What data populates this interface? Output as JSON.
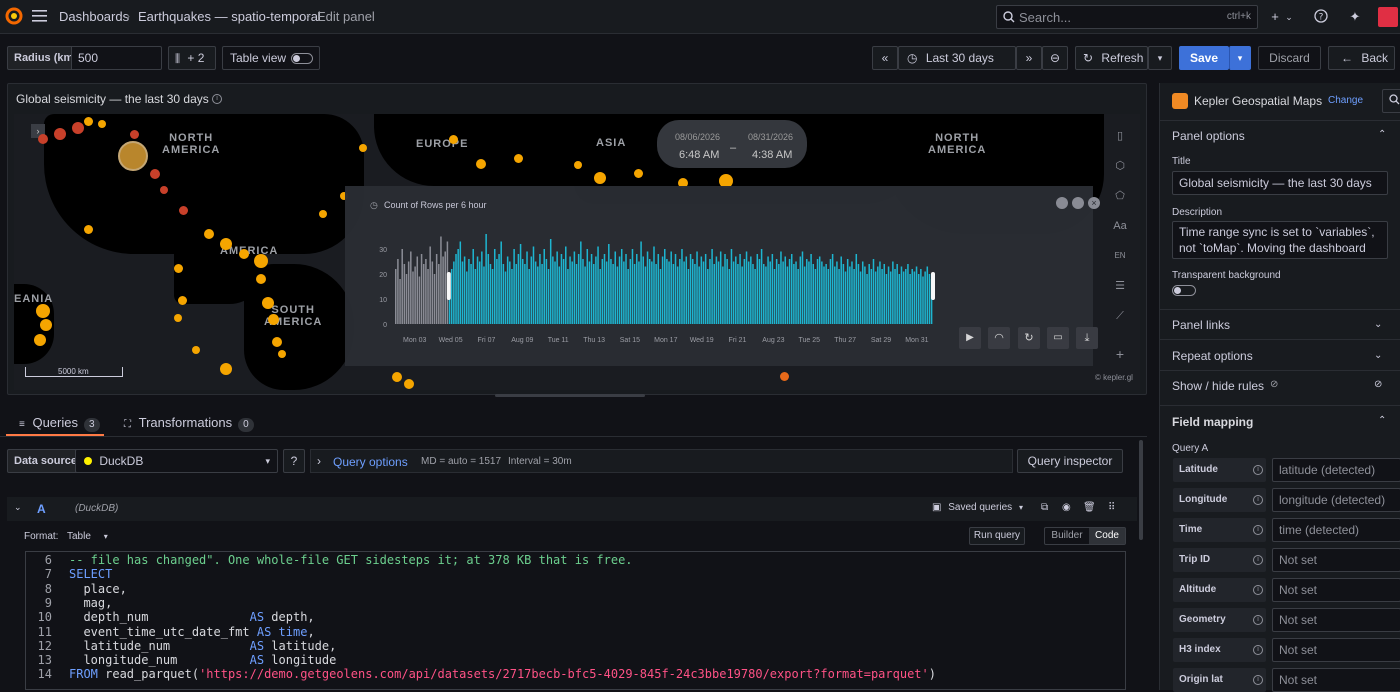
{
  "breadcrumb": [
    "Dashboards",
    "Earthquakes — spatio-temporal",
    "Edit panel"
  ],
  "search": {
    "placeholder": "Search...",
    "shortcut": "ctrl+k"
  },
  "toolbar": {
    "radius_label": "Radius (km)",
    "radius_value": "500",
    "extra_vars": "+ 2",
    "table_view": "Table view",
    "time_range": "Last 30 days",
    "refresh": "Refresh",
    "save": "Save",
    "discard": "Discard",
    "back": "Back"
  },
  "panel": {
    "title": "Global seismicity — the last 30 days",
    "map_labels": [
      "NORTH\nAMERICA",
      "EUROPE",
      "ASIA",
      "NORTH\nAMERICA",
      "AMERICA",
      "SOUTH\nAMERICA",
      "EANIA"
    ],
    "scale_label": "5000 km",
    "attribution": "© kepler.gl",
    "range_start_date": "08/06/2026",
    "range_start_time": "6:48 AM",
    "range_end_date": "08/31/2026",
    "range_end_time": "4:38 AM",
    "range_dash": "–"
  },
  "chart_data": {
    "type": "bar",
    "title": "Count of Rows per 6 hour",
    "ylim": [
      0,
      40
    ],
    "yticks": [
      0,
      10,
      20,
      30
    ],
    "xticks": [
      "Mon 03",
      "Wed 05",
      "Fri 07",
      "Aug 09",
      "Tue 11",
      "Thu 13",
      "Sat 15",
      "Mon 17",
      "Wed 19",
      "Fri 21",
      "Aug 23",
      "Tue 25",
      "Thu 27",
      "Sat 29",
      "Mon 31"
    ],
    "selected_start_index": 25,
    "values": [
      22,
      26,
      18,
      30,
      24,
      20,
      25,
      29,
      21,
      23,
      27,
      19,
      28,
      24,
      26,
      22,
      31,
      25,
      20,
      28,
      24,
      35,
      27,
      29,
      33,
      18,
      22,
      25,
      28,
      30,
      33,
      25,
      27,
      21,
      26,
      24,
      30,
      22,
      27,
      25,
      29,
      23,
      36,
      28,
      24,
      22,
      30,
      26,
      28,
      33,
      24,
      21,
      27,
      25,
      22,
      30,
      24,
      28,
      32,
      26,
      24,
      29,
      22,
      27,
      31,
      25,
      23,
      28,
      24,
      30,
      26,
      22,
      34,
      27,
      25,
      29,
      23,
      28,
      26,
      31,
      22,
      27,
      25,
      29,
      24,
      28,
      33,
      26,
      23,
      30,
      25,
      28,
      24,
      27,
      31,
      22,
      26,
      28,
      25,
      32,
      26,
      24,
      29,
      23,
      27,
      30,
      25,
      28,
      22,
      26,
      30,
      24,
      28,
      25,
      33,
      27,
      23,
      29,
      26,
      25,
      31,
      24,
      28,
      22,
      27,
      30,
      26,
      25,
      29,
      24,
      28,
      23,
      26,
      30,
      25,
      27,
      22,
      28,
      26,
      24,
      29,
      23,
      27,
      25,
      28,
      22,
      26,
      30,
      24,
      27,
      25,
      29,
      23,
      28,
      26,
      22,
      30,
      25,
      27,
      24,
      28,
      23,
      26,
      29,
      25,
      27,
      24,
      22,
      28,
      26,
      30,
      24,
      23,
      27,
      25,
      28,
      22,
      26,
      24,
      29,
      25,
      27,
      23,
      26,
      28,
      24,
      25,
      22,
      27,
      29,
      23,
      26,
      25,
      28,
      24,
      22,
      26,
      27,
      25,
      23,
      24,
      22,
      26,
      28,
      23,
      25,
      22,
      27,
      24,
      21,
      26,
      23,
      25,
      22,
      28,
      24,
      21,
      25,
      23,
      20,
      24,
      22,
      26,
      21,
      23,
      25,
      22,
      24,
      20,
      23,
      21,
      25,
      22,
      24,
      20,
      23,
      21,
      22,
      24,
      20,
      22,
      21,
      23,
      20,
      22,
      19,
      21,
      23,
      20,
      18
    ]
  },
  "queries": {
    "tab_queries": "Queries",
    "queries_count": "3",
    "tab_transformations": "Transformations",
    "transformations_count": "0",
    "datasource_label": "Data source",
    "datasource": "DuckDB",
    "query_options": "Query options",
    "md": "MD = auto = 1517",
    "interval": "Interval = 30m",
    "inspector": "Query inspector",
    "ref_id": "A",
    "ref_source": "(DuckDB)",
    "saved_queries": "Saved queries",
    "format_label": "Format:",
    "format_value": "Table",
    "run_query": "Run query",
    "builder": "Builder",
    "code": "Code"
  },
  "code_lines": [
    {
      "n": "6",
      "parts": [
        [
          "cm",
          "-- file has changed\". One whole-file GET sidesteps it; at 378 KB that is free."
        ]
      ]
    },
    {
      "n": "7",
      "parts": [
        [
          "kw",
          "SELECT"
        ]
      ]
    },
    {
      "n": "8",
      "parts": [
        [
          "",
          "  place,"
        ]
      ]
    },
    {
      "n": "9",
      "parts": [
        [
          "",
          "  mag,"
        ]
      ]
    },
    {
      "n": "10",
      "parts": [
        [
          "",
          "  depth_num              "
        ],
        [
          "kw",
          "AS"
        ],
        [
          "",
          " depth,"
        ]
      ]
    },
    {
      "n": "11",
      "parts": [
        [
          "",
          "  event_time_utc_date_fmt "
        ],
        [
          "kw",
          "AS"
        ],
        [
          "",
          " "
        ],
        [
          "kw",
          "time"
        ],
        [
          "",
          ","
        ]
      ]
    },
    {
      "n": "12",
      "parts": [
        [
          "",
          "  latitude_num           "
        ],
        [
          "kw",
          "AS"
        ],
        [
          "",
          " latitude,"
        ]
      ]
    },
    {
      "n": "13",
      "parts": [
        [
          "",
          "  longitude_num          "
        ],
        [
          "kw",
          "AS"
        ],
        [
          "",
          " longitude"
        ]
      ]
    },
    {
      "n": "14",
      "parts": [
        [
          "kw",
          "FROM"
        ],
        [
          "",
          " read_parquet("
        ],
        [
          "str",
          "'https://demo.getgeolens.com/api/datasets/2717becb-bfc5-4029-845f-24c3bbe19780/export?format=parquet'"
        ],
        [
          "",
          ")"
        ]
      ]
    }
  ],
  "sidebar": {
    "viz_name": "Kepler Geospatial Maps",
    "change": "Change",
    "panel_options": "Panel options",
    "title_label": "Title",
    "title_value": "Global seismicity — the last 30 days",
    "description_label": "Description",
    "description_value": "Time range sync is set to `variables`, not `toMap`. Moving the dashboard",
    "transparent_label": "Transparent background",
    "panel_links": "Panel links",
    "repeat_options": "Repeat options",
    "show_hide_rules": "Show / hide rules",
    "field_mapping": "Field mapping",
    "query_a": "Query A",
    "fields": [
      {
        "label": "Latitude",
        "value": "latitude (detected)"
      },
      {
        "label": "Longitude",
        "value": "longitude (detected)"
      },
      {
        "label": "Time",
        "value": "time (detected)"
      },
      {
        "label": "Trip ID",
        "value": "Not set"
      },
      {
        "label": "Altitude",
        "value": "Not set"
      },
      {
        "label": "Geometry",
        "value": "Not set"
      },
      {
        "label": "H3 index",
        "value": "Not set"
      },
      {
        "label": "Origin lat",
        "value": "Not set"
      }
    ]
  }
}
